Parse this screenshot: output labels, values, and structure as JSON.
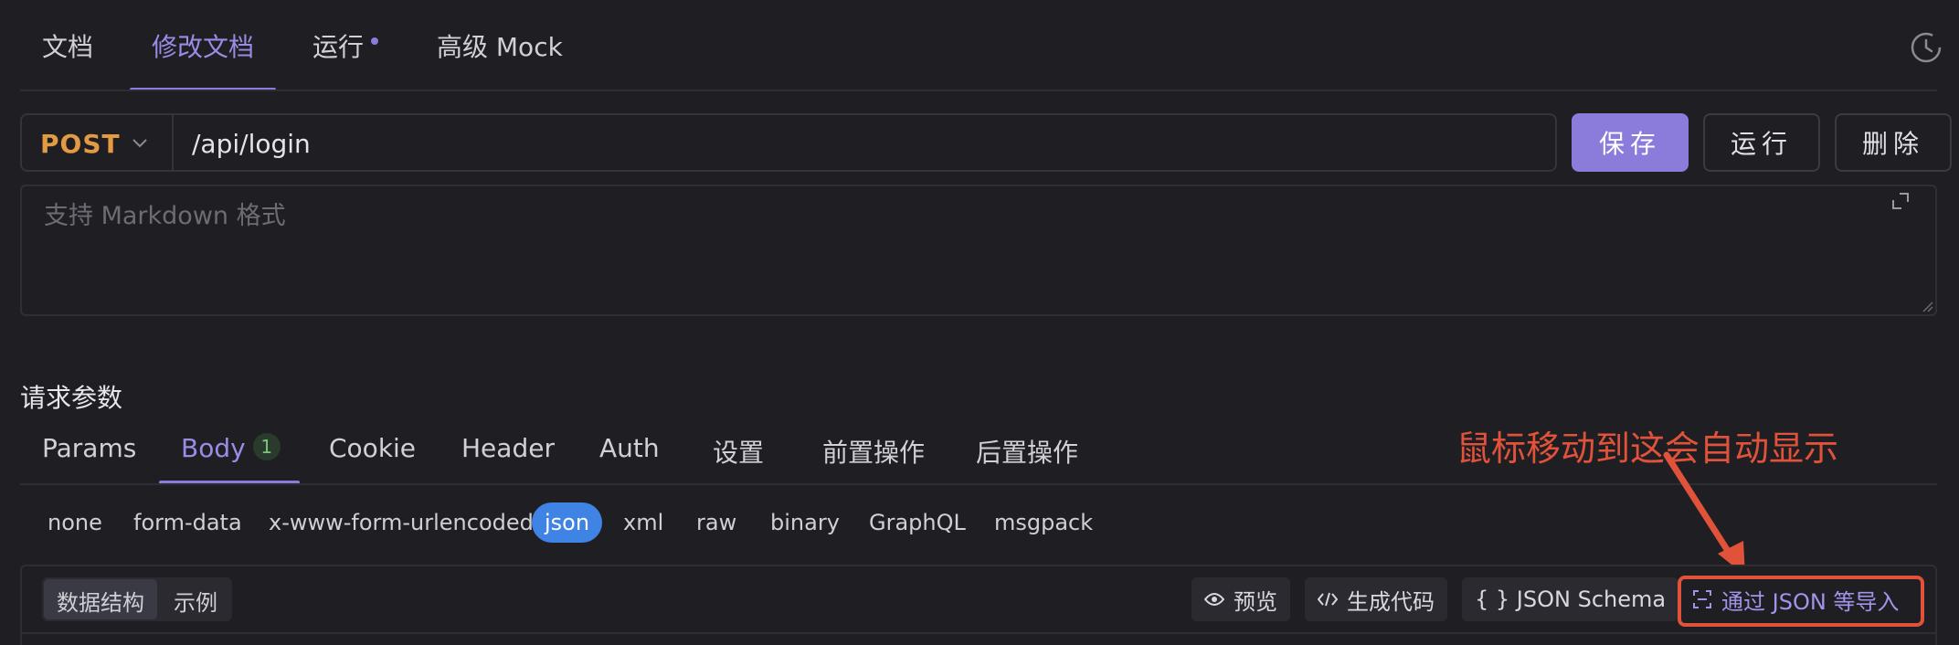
{
  "top_tabs": [
    {
      "label": "文档",
      "active": false
    },
    {
      "label": "修改文档",
      "active": true
    },
    {
      "label": "运行",
      "active": false
    },
    {
      "label": "高级 Mock",
      "active": false
    }
  ],
  "request": {
    "method": "POST",
    "url": "/api/login",
    "save_label": "保存",
    "run_label": "运行",
    "delete_label": "删除"
  },
  "description": {
    "placeholder": "支持 Markdown 格式"
  },
  "params_section": {
    "title": "请求参数",
    "tabs": [
      {
        "label": "Params"
      },
      {
        "label": "Body",
        "badge": "1",
        "active": true
      },
      {
        "label": "Cookie"
      },
      {
        "label": "Header"
      },
      {
        "label": "Auth"
      },
      {
        "label": "设置"
      },
      {
        "label": "前置操作"
      },
      {
        "label": "后置操作"
      }
    ]
  },
  "body_types": [
    "none",
    "form-data",
    "x-www-form-urlencoded",
    "json",
    "xml",
    "raw",
    "binary",
    "GraphQL",
    "msgpack"
  ],
  "body_type_selected": "json",
  "body_toolbar": {
    "segments": [
      "数据结构",
      "示例"
    ],
    "preview_label": "预览",
    "generate_code_label": "生成代码",
    "json_schema_label": "{ } JSON Schema",
    "import_label": "通过 JSON 等导入"
  },
  "annotation": {
    "text": "鼠标移动到这会自动显示",
    "color": "#e0523a"
  },
  "colors": {
    "accent": "#8b7cdc",
    "method": "#e29a43",
    "json_chip": "#3f84e4",
    "background": "#1f1f23"
  },
  "icons": [
    "history-icon",
    "chevron-down-icon",
    "expand-icon",
    "resize-handle-icon",
    "eye-icon",
    "code-icon",
    "scan-import-icon"
  ]
}
